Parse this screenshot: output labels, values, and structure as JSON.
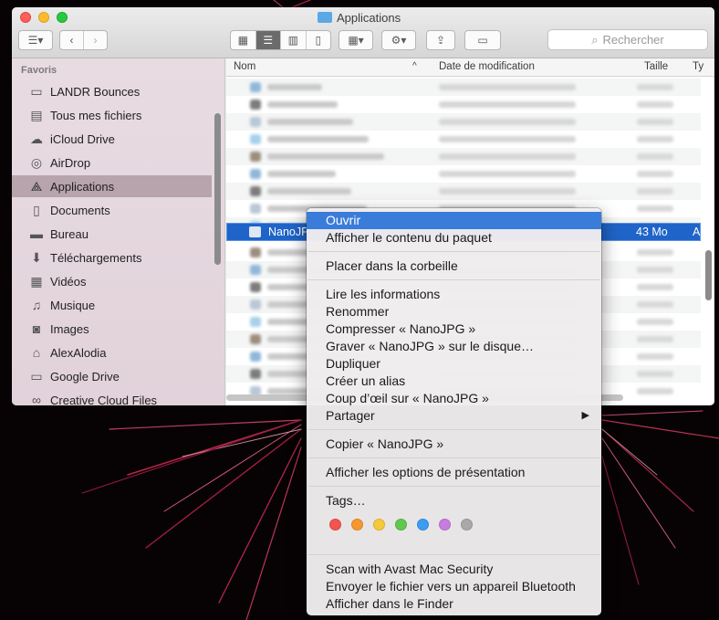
{
  "window": {
    "title": "Applications"
  },
  "toolbar": {
    "search_placeholder": "Rechercher",
    "sort_arrow": "^"
  },
  "sidebar": {
    "section_title": "Favoris",
    "items": [
      {
        "label": "LANDR Bounces",
        "icon": "folder-icon"
      },
      {
        "label": "Tous mes fichiers",
        "icon": "all-files-icon"
      },
      {
        "label": "iCloud Drive",
        "icon": "cloud-icon"
      },
      {
        "label": "AirDrop",
        "icon": "airdrop-icon"
      },
      {
        "label": "Applications",
        "icon": "applications-icon",
        "selected": true
      },
      {
        "label": "Documents",
        "icon": "documents-icon"
      },
      {
        "label": "Bureau",
        "icon": "desktop-icon"
      },
      {
        "label": "Téléchargements",
        "icon": "download-icon"
      },
      {
        "label": "Vidéos",
        "icon": "film-icon"
      },
      {
        "label": "Musique",
        "icon": "music-icon"
      },
      {
        "label": "Images",
        "icon": "camera-icon"
      },
      {
        "label": "AlexAlodia",
        "icon": "home-icon"
      },
      {
        "label": "Google Drive",
        "icon": "folder-icon"
      },
      {
        "label": "Creative Cloud Files",
        "icon": "creative-cloud-icon"
      }
    ]
  },
  "list": {
    "columns": {
      "name": "Nom",
      "date": "Date de modification",
      "size": "Taille",
      "type": "Ty"
    },
    "selected_row": {
      "name": "NanoJP",
      "size": "43 Mo",
      "type": "A"
    }
  },
  "menu": {
    "items": {
      "open": "Ouvrir",
      "show_contents": "Afficher le contenu du paquet",
      "trash": "Placer dans la corbeille",
      "get_info": "Lire les informations",
      "rename": "Renommer",
      "compress": "Compresser « NanoJPG »",
      "burn": "Graver « NanoJPG » sur le disque…",
      "duplicate": "Dupliquer",
      "alias": "Créer un alias",
      "quicklook": "Coup d’œil sur « NanoJPG »",
      "share": "Partager",
      "copy": "Copier « NanoJPG »",
      "view_options": "Afficher les options de présentation",
      "tags": "Tags…",
      "avast": "Scan with Avast Mac Security",
      "bluetooth": "Envoyer le fichier vers un appareil Bluetooth",
      "show_in_finder": "Afficher dans le Finder"
    },
    "share_arrow": "▶",
    "tag_colors": [
      "#f2544f",
      "#f7962f",
      "#f5c93c",
      "#5fc84d",
      "#3c9cf1",
      "#c77ce0",
      "#a9a9a9"
    ]
  },
  "colors": {
    "accent": "#3a7cd9",
    "selection": "#1f64c8"
  }
}
